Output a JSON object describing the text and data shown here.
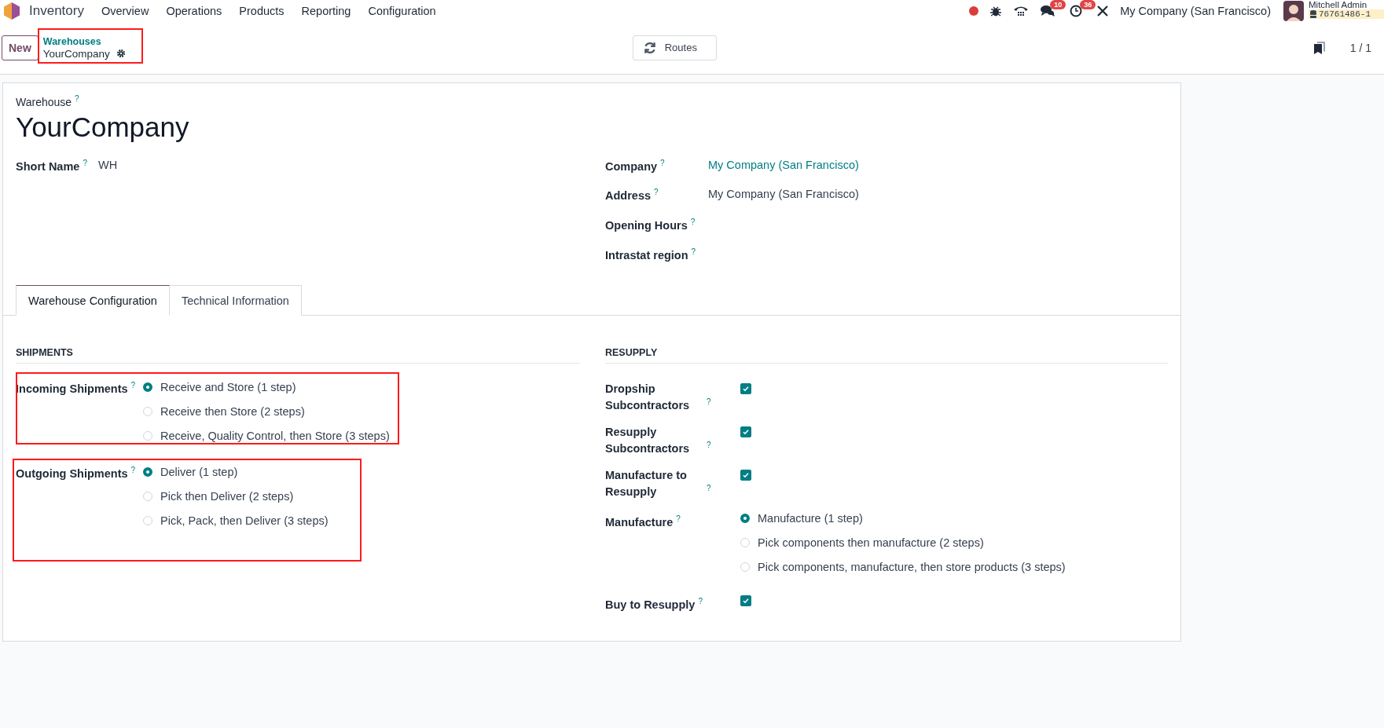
{
  "navbar": {
    "app_name": "Inventory",
    "menu": [
      "Overview",
      "Operations",
      "Products",
      "Reporting",
      "Configuration"
    ],
    "messages_badge": "10",
    "activities_badge": "36",
    "company": "My Company (San Francisco)",
    "user": "Mitchell Admin",
    "database": "76761486-1"
  },
  "control_panel": {
    "new_button": "New",
    "breadcrumb": {
      "parent": "Warehouses",
      "current": "YourCompany",
      "highlighted": true
    },
    "routes_button": "Routes",
    "pager": "1 / 1"
  },
  "form": {
    "title_label": "Warehouse",
    "title_help": "?",
    "name": "YourCompany",
    "left_fields": [
      {
        "label": "Short Name",
        "help": "?",
        "value": "WH",
        "link": false
      }
    ],
    "right_fields": [
      {
        "label": "Company",
        "help": "?",
        "value": "My Company (San Francisco)",
        "link": true
      },
      {
        "label": "Address",
        "help": "?",
        "value": "My Company (San Francisco)",
        "link": false
      },
      {
        "label": "Opening Hours",
        "help": "?"
      },
      {
        "label": "Intrastat region",
        "help": "?"
      }
    ],
    "tabs": [
      {
        "label": "Warehouse Configuration",
        "selected": true
      },
      {
        "label": "Technical Information",
        "selected": false
      }
    ],
    "shipments": {
      "title": "SHIPMENTS",
      "groups": [
        {
          "label": "Incoming Shipments",
          "help": "?",
          "highlighted": true,
          "options": [
            {
              "label": "Receive and Store (1 step)",
              "selected": true
            },
            {
              "label": "Receive then Store (2 steps)",
              "selected": false
            },
            {
              "label": "Receive, Quality Control, then Store (3 steps)",
              "selected": false
            }
          ]
        },
        {
          "label": "Outgoing Shipments",
          "help": "?",
          "highlighted": true,
          "options": [
            {
              "label": "Deliver (1 step)",
              "selected": true
            },
            {
              "label": "Pick then Deliver (2 steps)",
              "selected": false
            },
            {
              "label": "Pick, Pack, then Deliver (3 steps)",
              "selected": false
            }
          ]
        }
      ]
    },
    "resupply": {
      "title": "RESUPPLY",
      "rows": [
        {
          "kind": "checkbox",
          "label": "Dropship Subcontractors",
          "help": "?",
          "checked": true
        },
        {
          "kind": "checkbox",
          "label": "Resupply Subcontractors",
          "help": "?",
          "checked": true
        },
        {
          "kind": "checkbox",
          "label": "Manufacture to Resupply",
          "help": "?",
          "checked": true
        },
        {
          "kind": "radio",
          "label": "Manufacture",
          "help": "?",
          "options": [
            {
              "label": "Manufacture (1 step)",
              "selected": true
            },
            {
              "label": "Pick components then manufacture (2 steps)",
              "selected": false
            },
            {
              "label": "Pick components, manufacture, then store products (3 steps)",
              "selected": false
            }
          ]
        },
        {
          "kind": "checkbox",
          "label": "Buy to Resupply",
          "help": "?",
          "checked": true
        }
      ]
    }
  }
}
